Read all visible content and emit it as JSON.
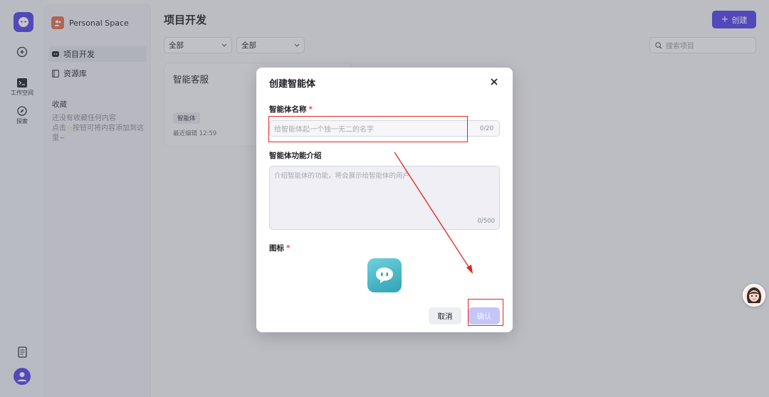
{
  "rail": {
    "workspace_label": "工作空间",
    "explore_label": "探索"
  },
  "sidebar": {
    "space_name": "Personal Space",
    "items": [
      {
        "label": "项目开发"
      },
      {
        "label": "资源库"
      }
    ],
    "favorites_title": "收藏",
    "favorites_empty_line1": "还没有收藏任何内容",
    "favorites_empty_line2_prefix": "点击",
    "favorites_empty_line2_suffix": "按钮可将内容添加到这里~"
  },
  "header": {
    "title": "项目开发",
    "create_label": "创建"
  },
  "filters": {
    "filter1": "全部",
    "filter2": "全部",
    "search_placeholder": "搜索项目"
  },
  "card": {
    "title": "智能客服",
    "tag": "智能体",
    "edited": "最近编辑 12:59"
  },
  "dialog": {
    "title": "创建智能体",
    "name_label": "智能体名称",
    "name_placeholder": "给智能体起一个独一无二的名字",
    "name_count": "0/20",
    "desc_label": "智能体功能介绍",
    "desc_placeholder": "介绍智能体的功能，将会展示给智能体的用户",
    "desc_count": "0/500",
    "icon_label": "图标",
    "required_mark": "*",
    "cancel_label": "取消",
    "confirm_label": "确认"
  },
  "colors": {
    "accent": "#4e40e5",
    "annotation": "#e5251e",
    "icon_gradient_top": "#6fd0dd",
    "icon_gradient_bottom": "#2fa3b6"
  }
}
